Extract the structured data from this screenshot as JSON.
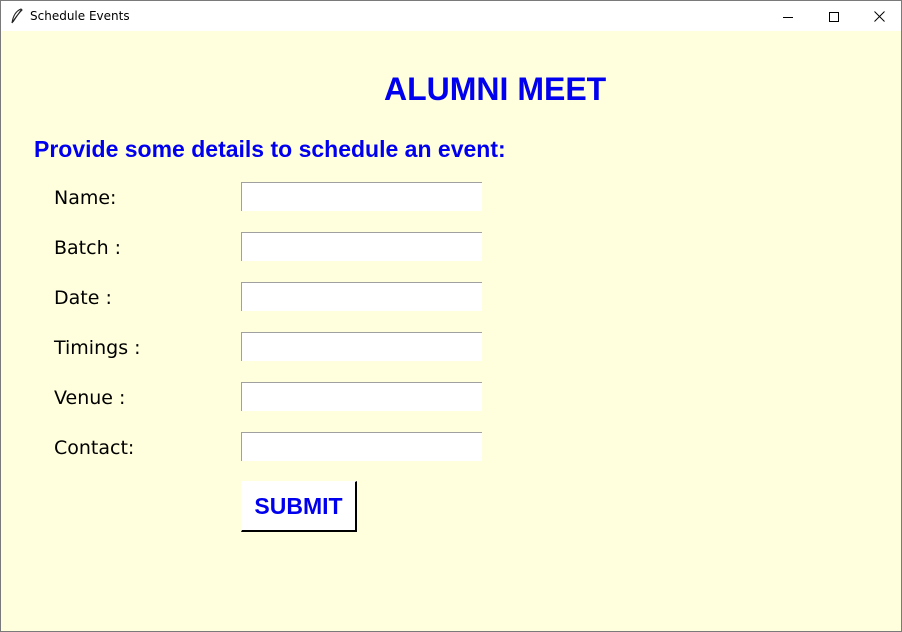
{
  "window": {
    "title": "Schedule Events",
    "icon": "feather-icon",
    "controls": [
      "minimize-icon",
      "maximize-icon",
      "close-icon"
    ]
  },
  "heading": "ALUMNI MEET",
  "subheading": "Provide some details to schedule an event:",
  "fields": [
    {
      "label": "Name:",
      "value": ""
    },
    {
      "label": "Batch :",
      "value": ""
    },
    {
      "label": "Date :",
      "value": ""
    },
    {
      "label": "Timings :",
      "value": ""
    },
    {
      "label": "Venue :",
      "value": ""
    },
    {
      "label": "Contact:",
      "value": ""
    }
  ],
  "submit_label": "SUBMIT",
  "colors": {
    "background": "#ffffdd",
    "accent": "#0000ee",
    "input_bg": "#ffffff"
  }
}
